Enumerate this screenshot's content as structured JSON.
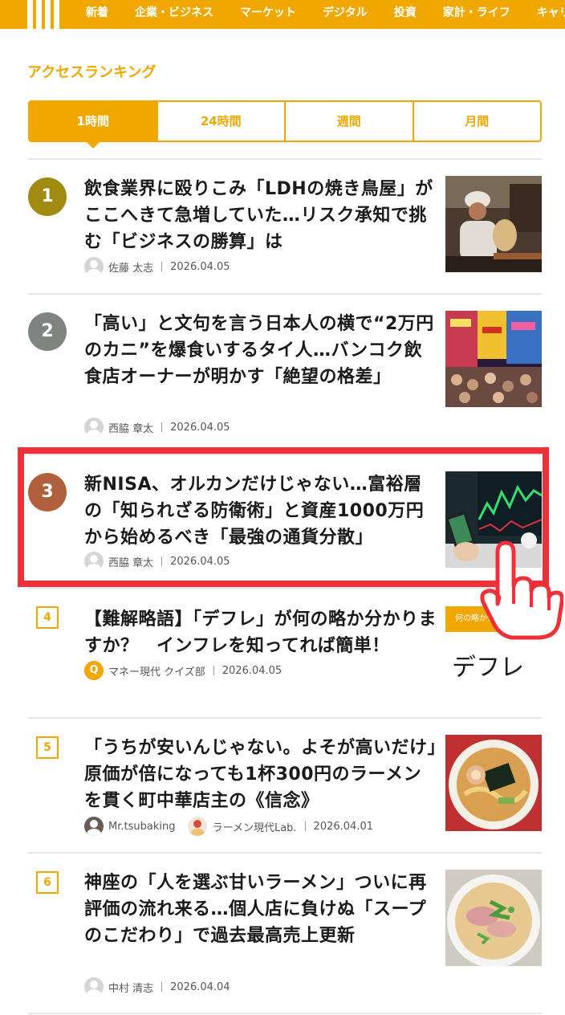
{
  "nav": {
    "items": [
      "新着",
      "企業・ビジネス",
      "マーケット",
      "デジタル",
      "投資",
      "家計・ライフ",
      "キャリア・"
    ]
  },
  "section_title": "アクセスランキング",
  "tabs": [
    {
      "label": "1時間",
      "active": true
    },
    {
      "label": "24時間",
      "active": false
    },
    {
      "label": "週間",
      "active": false
    },
    {
      "label": "月間",
      "active": false
    }
  ],
  "articles": [
    {
      "rank": "1",
      "title": "飲食業界に殴りこみ「LDHの焼き鳥屋」がここへきて急増していた…リスク承知で挑む「ビジネスの勝算」は",
      "author": "佐藤 太志",
      "date": "2026.04.05"
    },
    {
      "rank": "2",
      "title": "「高い」と文句を言う日本人の横で“2万円のカニ”を爆食いするタイ人…バンコク飲食店オーナーが明かす「絶望の格差」",
      "author": "西脇 章太",
      "date": "2026.04.05"
    },
    {
      "rank": "3",
      "title": "新NISA、オルカンだけじゃない…富裕層の「知られざる防衛術」と資産1000万円から始めるべき「最強の通貨分散」",
      "author": "西脇 章太",
      "date": "2026.04.05"
    },
    {
      "rank": "4",
      "title": "【難解略語】「デフレ」が何の略か分かりますか？　インフレを知ってれば簡単！",
      "author": "マネー現代 クイズ部",
      "author_icon_text": "Q",
      "date": "2026.04.05",
      "thumb_caption": "何の略か分",
      "thumb_text": "デフレ"
    },
    {
      "rank": "5",
      "title": "「うちが安いんじゃない。よそが高いだけ」原価が倍になっても1杯300円のラーメンを貫く町中華店主の《信念》",
      "author": "Mr.tsubaking",
      "author2": "ラーメン現代Lab.",
      "date": "2026.04.01"
    },
    {
      "rank": "6",
      "title": "神座の「人を選ぶ甘いラーメン」ついに再評価の流れ来る…個人店に負けぬ「スープのこだわり」で過去最高売上更新",
      "author": "中村 清志",
      "date": "2026.04.04"
    }
  ],
  "colors": {
    "brand": "#f0a800",
    "gold": "#a08a10",
    "silver": "#7f8480",
    "bronze": "#b0603a",
    "highlight": "#f03038"
  }
}
